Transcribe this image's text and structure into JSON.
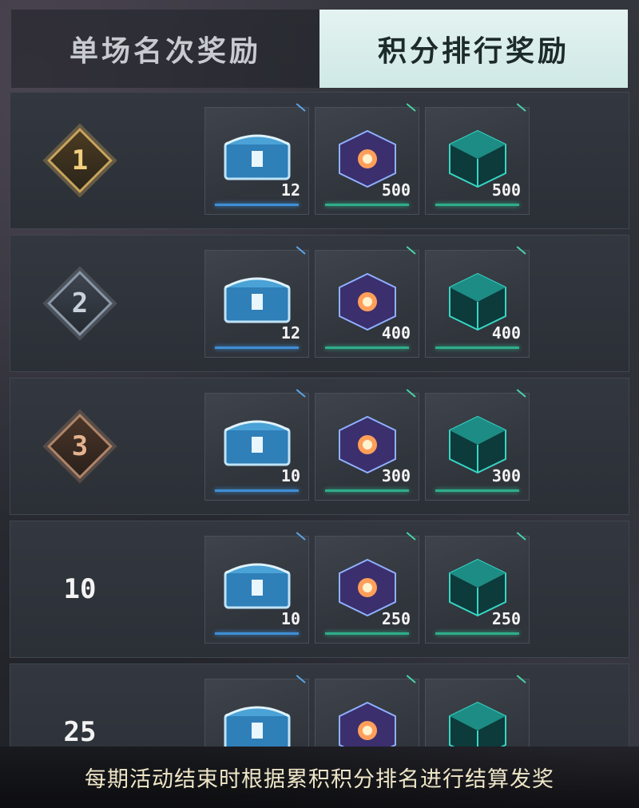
{
  "tabs": {
    "single_match": "单场名次奖励",
    "points_ranking": "积分排行奖励"
  },
  "rows": [
    {
      "rank": "1",
      "items": [
        {
          "icon": "blue-chest-icon",
          "qty": "12"
        },
        {
          "icon": "energy-cube-icon",
          "qty": "500"
        },
        {
          "icon": "teal-cube-icon",
          "qty": "500"
        }
      ]
    },
    {
      "rank": "2",
      "items": [
        {
          "icon": "blue-chest-icon",
          "qty": "12"
        },
        {
          "icon": "energy-cube-icon",
          "qty": "400"
        },
        {
          "icon": "teal-cube-icon",
          "qty": "400"
        }
      ]
    },
    {
      "rank": "3",
      "items": [
        {
          "icon": "blue-chest-icon",
          "qty": "10"
        },
        {
          "icon": "energy-cube-icon",
          "qty": "300"
        },
        {
          "icon": "teal-cube-icon",
          "qty": "300"
        }
      ]
    },
    {
      "rank": "10",
      "items": [
        {
          "icon": "blue-chest-icon",
          "qty": "10"
        },
        {
          "icon": "energy-cube-icon",
          "qty": "250"
        },
        {
          "icon": "teal-cube-icon",
          "qty": "250"
        }
      ]
    },
    {
      "rank": "25",
      "items": [
        {
          "icon": "blue-chest-icon",
          "qty": ""
        },
        {
          "icon": "energy-cube-icon",
          "qty": ""
        },
        {
          "icon": "teal-cube-icon",
          "qty": ""
        }
      ]
    }
  ],
  "footer": "每期活动结束时根据累积积分排名进行结算发奖",
  "colors": {
    "active_tab": "#d8ecea",
    "blue_accent": "#3f8fd6",
    "green_accent": "#2fae8a"
  }
}
